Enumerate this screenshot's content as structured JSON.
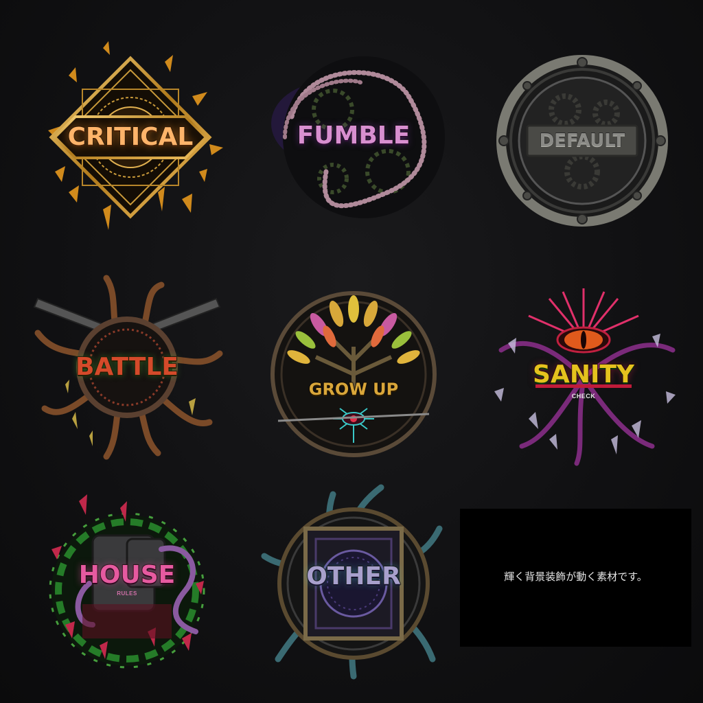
{
  "badges": {
    "critical": {
      "title": "CRITICAL",
      "accent": "#d4a43a"
    },
    "fumble": {
      "title": "FUMBLE",
      "accent": "#7a4ca0"
    },
    "default": {
      "title": "DEFAULT",
      "accent": "#8a8a86"
    },
    "battle": {
      "title": "BATTLE",
      "accent": "#c8502a"
    },
    "growup": {
      "title": "GROW UP",
      "accent": "#e0b43c"
    },
    "sanity": {
      "title": "SANITY",
      "subtitle": "CHECK",
      "accent": "#c01c6a"
    },
    "house": {
      "title": "HOUSE",
      "subtitle": "RULES",
      "accent": "#38c040"
    },
    "other": {
      "title": "OTHER",
      "accent": "#3a8fa0"
    }
  },
  "note": {
    "text": "輝く背景装飾が動く素材です。"
  }
}
